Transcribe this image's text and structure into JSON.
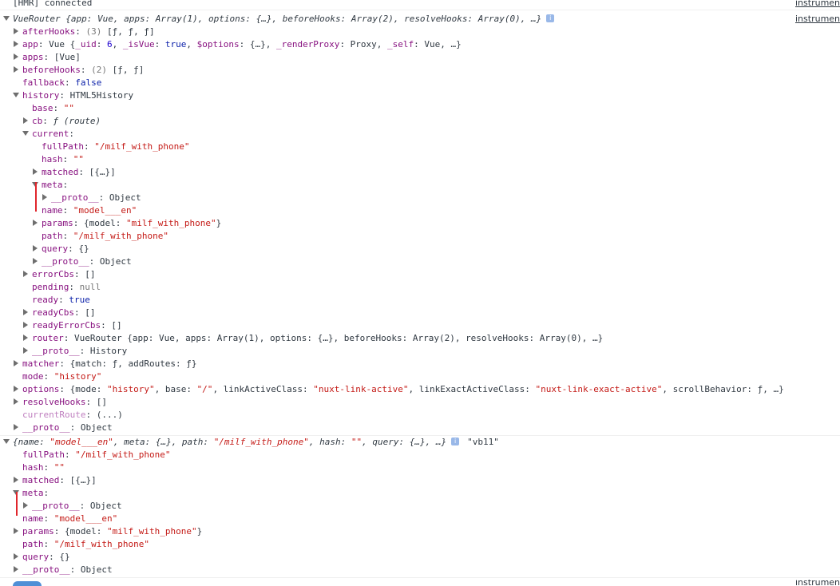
{
  "console": {
    "hmr": {
      "text": "[HMR] connected",
      "source": "instrumentation"
    },
    "log1_source": "instrumentation",
    "log1": [
      {
        "d": 0,
        "a": "open",
        "parts": [
          {
            "c": "it pl",
            "t": "VueRouter {app: Vue, apps: Array(1), options: {…}, beforeHooks: Array(2), resolveHooks: Array(0), …}"
          }
        ],
        "info": "i"
      },
      {
        "d": 1,
        "a": "closed",
        "parts": [
          {
            "c": "key",
            "t": "afterHooks"
          },
          {
            "c": "pl",
            "t": ": "
          },
          {
            "c": "dimtxt",
            "t": "(3) "
          },
          {
            "c": "pl",
            "t": "[ƒ, ƒ, ƒ]"
          }
        ]
      },
      {
        "d": 1,
        "a": "closed",
        "parts": [
          {
            "c": "key",
            "t": "app"
          },
          {
            "c": "pl",
            "t": ": Vue {"
          },
          {
            "c": "key",
            "t": "_uid"
          },
          {
            "c": "pl",
            "t": ": "
          },
          {
            "c": "n",
            "t": "6"
          },
          {
            "c": "pl",
            "t": ", "
          },
          {
            "c": "key",
            "t": "_isVue"
          },
          {
            "c": "pl",
            "t": ": "
          },
          {
            "c": "k",
            "t": "true"
          },
          {
            "c": "pl",
            "t": ", "
          },
          {
            "c": "key",
            "t": "$options"
          },
          {
            "c": "pl",
            "t": ": {…}, "
          },
          {
            "c": "key",
            "t": "_renderProxy"
          },
          {
            "c": "pl",
            "t": ": Proxy, "
          },
          {
            "c": "key",
            "t": "_self"
          },
          {
            "c": "pl",
            "t": ": Vue, …}"
          }
        ]
      },
      {
        "d": 1,
        "a": "closed",
        "parts": [
          {
            "c": "key",
            "t": "apps"
          },
          {
            "c": "pl",
            "t": ": [Vue]"
          }
        ]
      },
      {
        "d": 1,
        "a": "closed",
        "parts": [
          {
            "c": "key",
            "t": "beforeHooks"
          },
          {
            "c": "pl",
            "t": ": "
          },
          {
            "c": "dimtxt",
            "t": "(2) "
          },
          {
            "c": "pl",
            "t": "[ƒ, ƒ]"
          }
        ]
      },
      {
        "d": 1,
        "a": "none",
        "parts": [
          {
            "c": "key",
            "t": "fallback"
          },
          {
            "c": "pl",
            "t": ": "
          },
          {
            "c": "k",
            "t": "false"
          }
        ]
      },
      {
        "d": 1,
        "a": "open",
        "parts": [
          {
            "c": "key",
            "t": "history"
          },
          {
            "c": "pl",
            "t": ": HTML5History"
          }
        ]
      },
      {
        "d": 2,
        "a": "none",
        "parts": [
          {
            "c": "key",
            "t": "base"
          },
          {
            "c": "pl",
            "t": ": "
          },
          {
            "c": "s",
            "t": "\"\""
          }
        ]
      },
      {
        "d": 2,
        "a": "closed",
        "parts": [
          {
            "c": "key",
            "t": "cb"
          },
          {
            "c": "pl",
            "t": ": "
          },
          {
            "c": "it pl",
            "t": "ƒ (route)"
          }
        ]
      },
      {
        "d": 2,
        "a": "open",
        "parts": [
          {
            "c": "key",
            "t": "current"
          },
          {
            "c": "pl",
            "t": ":"
          }
        ]
      },
      {
        "d": 3,
        "a": "none",
        "parts": [
          {
            "c": "key",
            "t": "fullPath"
          },
          {
            "c": "pl",
            "t": ": "
          },
          {
            "c": "s",
            "t": "\"/milf_with_phone\""
          }
        ]
      },
      {
        "d": 3,
        "a": "none",
        "parts": [
          {
            "c": "key",
            "t": "hash"
          },
          {
            "c": "pl",
            "t": ": "
          },
          {
            "c": "s",
            "t": "\"\""
          }
        ]
      },
      {
        "d": 3,
        "a": "closed",
        "parts": [
          {
            "c": "key",
            "t": "matched"
          },
          {
            "c": "pl",
            "t": ": [{…}]"
          }
        ]
      },
      {
        "d": 3,
        "a": "open",
        "parts": [
          {
            "c": "key",
            "t": "meta"
          },
          {
            "c": "pl",
            "t": ":"
          }
        ]
      },
      {
        "d": 4,
        "a": "closed",
        "parts": [
          {
            "c": "key",
            "t": "__proto__"
          },
          {
            "c": "pl",
            "t": ": Object"
          }
        ]
      },
      {
        "d": 3,
        "a": "none",
        "parts": [
          {
            "c": "key",
            "t": "name"
          },
          {
            "c": "pl",
            "t": ": "
          },
          {
            "c": "s",
            "t": "\"model___en\""
          }
        ]
      },
      {
        "d": 3,
        "a": "closed",
        "parts": [
          {
            "c": "key",
            "t": "params"
          },
          {
            "c": "pl",
            "t": ": {model: "
          },
          {
            "c": "s",
            "t": "\"milf_with_phone\""
          },
          {
            "c": "pl",
            "t": "}"
          }
        ]
      },
      {
        "d": 3,
        "a": "none",
        "parts": [
          {
            "c": "key",
            "t": "path"
          },
          {
            "c": "pl",
            "t": ": "
          },
          {
            "c": "s",
            "t": "\"/milf_with_phone\""
          }
        ]
      },
      {
        "d": 3,
        "a": "closed",
        "parts": [
          {
            "c": "key",
            "t": "query"
          },
          {
            "c": "pl",
            "t": ": {}"
          }
        ]
      },
      {
        "d": 3,
        "a": "closed",
        "parts": [
          {
            "c": "key",
            "t": "__proto__"
          },
          {
            "c": "pl",
            "t": ": Object"
          }
        ]
      },
      {
        "d": 2,
        "a": "closed",
        "parts": [
          {
            "c": "key",
            "t": "errorCbs"
          },
          {
            "c": "pl",
            "t": ": []"
          }
        ]
      },
      {
        "d": 2,
        "a": "none",
        "parts": [
          {
            "c": "key",
            "t": "pending"
          },
          {
            "c": "pl",
            "t": ": "
          },
          {
            "c": "dimtxt",
            "t": "null"
          }
        ]
      },
      {
        "d": 2,
        "a": "none",
        "parts": [
          {
            "c": "key",
            "t": "ready"
          },
          {
            "c": "pl",
            "t": ": "
          },
          {
            "c": "k",
            "t": "true"
          }
        ]
      },
      {
        "d": 2,
        "a": "closed",
        "parts": [
          {
            "c": "key",
            "t": "readyCbs"
          },
          {
            "c": "pl",
            "t": ": []"
          }
        ]
      },
      {
        "d": 2,
        "a": "closed",
        "parts": [
          {
            "c": "key",
            "t": "readyErrorCbs"
          },
          {
            "c": "pl",
            "t": ": []"
          }
        ]
      },
      {
        "d": 2,
        "a": "closed",
        "parts": [
          {
            "c": "key",
            "t": "router"
          },
          {
            "c": "pl",
            "t": ": VueRouter {app: Vue, apps: Array(1), options: {…}, beforeHooks: Array(2), resolveHooks: Array(0), …}"
          }
        ]
      },
      {
        "d": 2,
        "a": "closed",
        "parts": [
          {
            "c": "key",
            "t": "__proto__"
          },
          {
            "c": "pl",
            "t": ": History"
          }
        ]
      },
      {
        "d": 1,
        "a": "closed",
        "parts": [
          {
            "c": "key",
            "t": "matcher"
          },
          {
            "c": "pl",
            "t": ": {match: ƒ, addRoutes: ƒ}"
          }
        ]
      },
      {
        "d": 1,
        "a": "none",
        "parts": [
          {
            "c": "key",
            "t": "mode"
          },
          {
            "c": "pl",
            "t": ": "
          },
          {
            "c": "s",
            "t": "\"history\""
          }
        ]
      },
      {
        "d": 1,
        "a": "closed",
        "parts": [
          {
            "c": "key",
            "t": "options"
          },
          {
            "c": "pl",
            "t": ": {mode: "
          },
          {
            "c": "s",
            "t": "\"history\""
          },
          {
            "c": "pl",
            "t": ", base: "
          },
          {
            "c": "s",
            "t": "\"/\""
          },
          {
            "c": "pl",
            "t": ", linkActiveClass: "
          },
          {
            "c": "s",
            "t": "\"nuxt-link-active\""
          },
          {
            "c": "pl",
            "t": ", linkExactActiveClass: "
          },
          {
            "c": "s",
            "t": "\"nuxt-link-exact-active\""
          },
          {
            "c": "pl",
            "t": ", scrollBehavior: ƒ, …}"
          }
        ]
      },
      {
        "d": 1,
        "a": "closed",
        "parts": [
          {
            "c": "key",
            "t": "resolveHooks"
          },
          {
            "c": "pl",
            "t": ": []"
          }
        ]
      },
      {
        "d": 1,
        "a": "none",
        "parts": [
          {
            "c": "key dim",
            "t": "currentRoute"
          },
          {
            "c": "pl",
            "t": ": (...)"
          }
        ]
      },
      {
        "d": 1,
        "a": "closed",
        "parts": [
          {
            "c": "key",
            "t": "__proto__"
          },
          {
            "c": "pl",
            "t": ": Object"
          }
        ]
      }
    ],
    "log2": [
      {
        "d": 0,
        "a": "open",
        "parts": [
          {
            "c": "it pl",
            "t": "{name: "
          },
          {
            "c": "it s",
            "t": "\"model___en\""
          },
          {
            "c": "it pl",
            "t": ", meta: {…}, path: "
          },
          {
            "c": "it s",
            "t": "\"/milf_with_phone\""
          },
          {
            "c": "it pl",
            "t": ", hash: "
          },
          {
            "c": "it s",
            "t": "\"\""
          },
          {
            "c": "it pl",
            "t": ", query: {…}, …}"
          }
        ],
        "info": "i",
        "suffix": "\"vb11\""
      },
      {
        "d": 1,
        "a": "none",
        "parts": [
          {
            "c": "key",
            "t": "fullPath"
          },
          {
            "c": "pl",
            "t": ": "
          },
          {
            "c": "s",
            "t": "\"/milf_with_phone\""
          }
        ]
      },
      {
        "d": 1,
        "a": "none",
        "parts": [
          {
            "c": "key",
            "t": "hash"
          },
          {
            "c": "pl",
            "t": ": "
          },
          {
            "c": "s",
            "t": "\"\""
          }
        ]
      },
      {
        "d": 1,
        "a": "closed",
        "parts": [
          {
            "c": "key",
            "t": "matched"
          },
          {
            "c": "pl",
            "t": ": [{…}]"
          }
        ]
      },
      {
        "d": 1,
        "a": "open",
        "parts": [
          {
            "c": "key",
            "t": "meta"
          },
          {
            "c": "pl",
            "t": ":"
          }
        ]
      },
      {
        "d": 2,
        "a": "closed",
        "parts": [
          {
            "c": "key",
            "t": "__proto__"
          },
          {
            "c": "pl",
            "t": ": Object"
          }
        ]
      },
      {
        "d": 1,
        "a": "none",
        "parts": [
          {
            "c": "key",
            "t": "name"
          },
          {
            "c": "pl",
            "t": ": "
          },
          {
            "c": "s",
            "t": "\"model___en\""
          }
        ]
      },
      {
        "d": 1,
        "a": "closed",
        "parts": [
          {
            "c": "key",
            "t": "params"
          },
          {
            "c": "pl",
            "t": ": {model: "
          },
          {
            "c": "s",
            "t": "\"milf_with_phone\""
          },
          {
            "c": "pl",
            "t": "}"
          }
        ]
      },
      {
        "d": 1,
        "a": "none",
        "parts": [
          {
            "c": "key",
            "t": "path"
          },
          {
            "c": "pl",
            "t": ": "
          },
          {
            "c": "s",
            "t": "\"/milf_with_phone\""
          }
        ]
      },
      {
        "d": 1,
        "a": "closed",
        "parts": [
          {
            "c": "key",
            "t": "query"
          },
          {
            "c": "pl",
            "t": ": {}"
          }
        ]
      },
      {
        "d": 1,
        "a": "closed",
        "parts": [
          {
            "c": "key",
            "t": "__proto__"
          },
          {
            "c": "pl",
            "t": ": Object"
          }
        ]
      }
    ],
    "bottom_source": "instrumentation"
  },
  "colors": {
    "key": "#881280",
    "string": "#c41a16",
    "number": "#1c00cf",
    "keyword": "#0d22aa",
    "annotation": "#e0262c"
  }
}
